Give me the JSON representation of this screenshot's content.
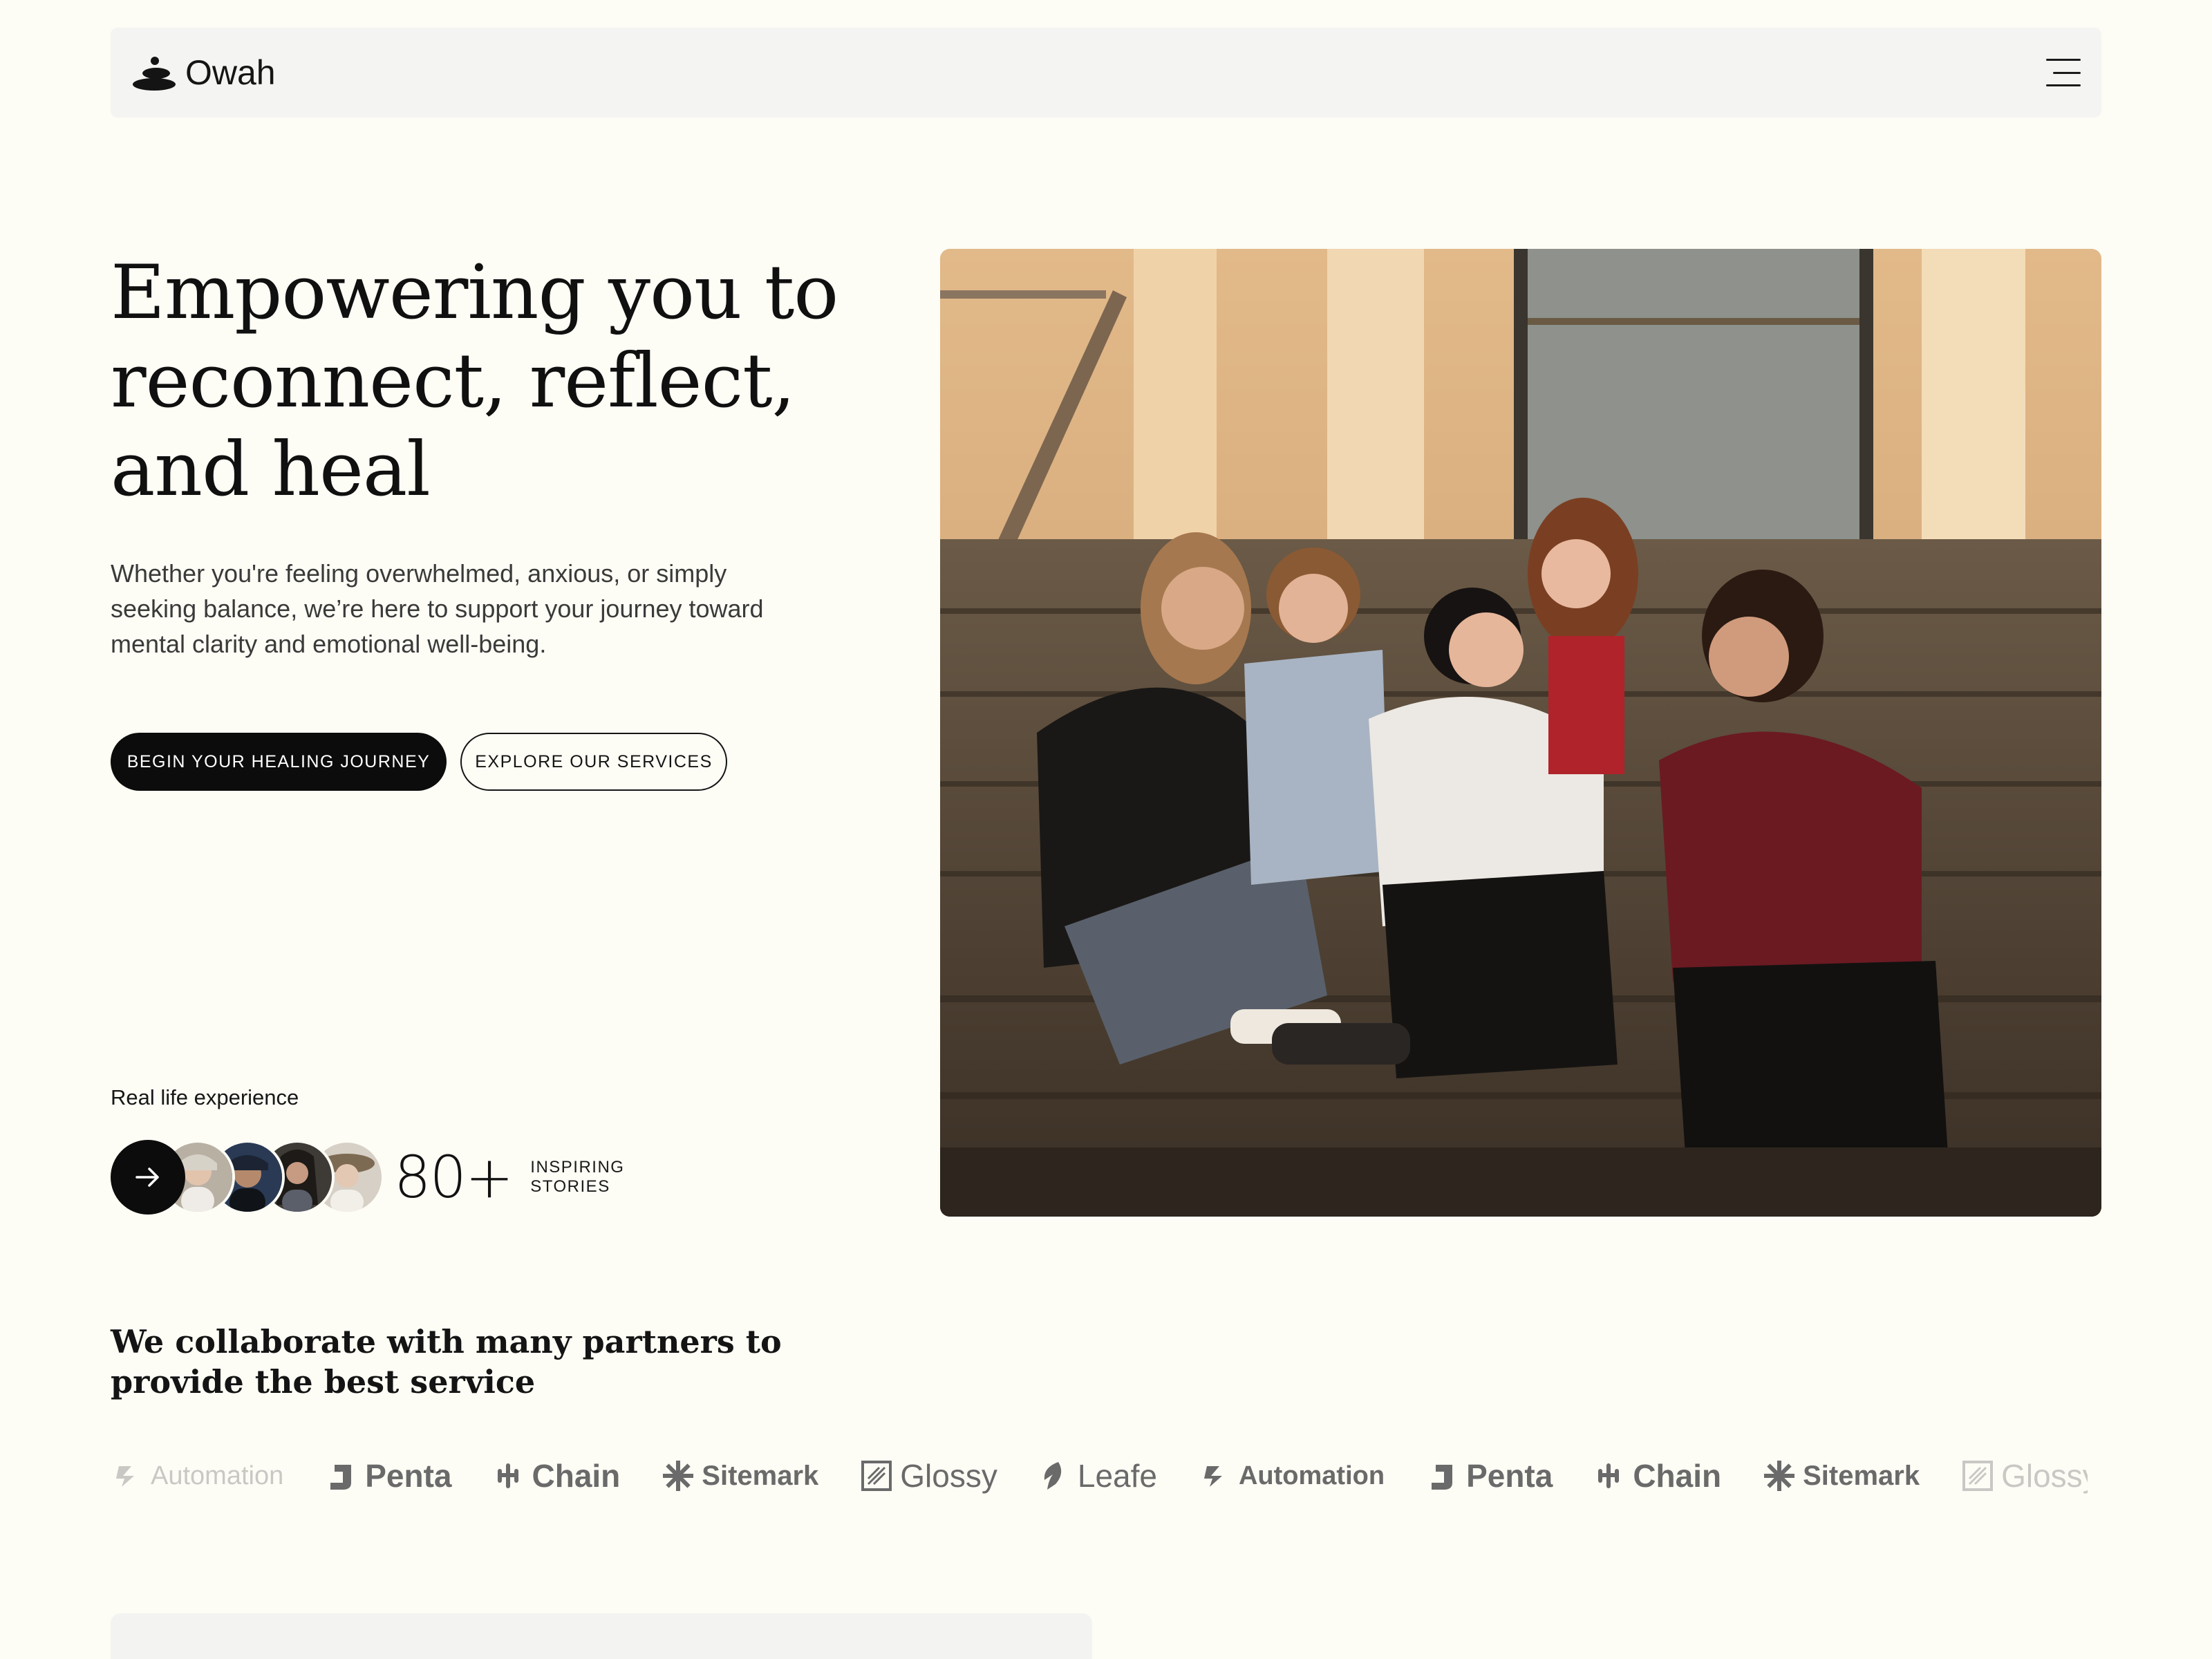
{
  "brand": {
    "name": "Owah",
    "logo_icon": "stones-icon"
  },
  "nav": {
    "menu_icon": "menu-icon"
  },
  "hero": {
    "title": "Empowering you to reconnect, reflect, and heal",
    "description": "Whether you're feeling overwhelmed, anxious, or simply seeking balance, we’re here to support your journey toward mental clarity and emotional well-being.",
    "primary_cta": "BEGIN YOUR HEALING JOURNEY",
    "secondary_cta": "EXPLORE OUR SERVICES"
  },
  "stories": {
    "caption": "Real life experience",
    "count": "80+",
    "label_line1": "INSPIRING",
    "label_line2": "STORIES"
  },
  "partners": {
    "title": "We collaborate with many partners to provide the best service",
    "logos": [
      {
        "name": "Automation",
        "icon": "automation-icon",
        "faded": true
      },
      {
        "name": "Penta",
        "icon": "penta-icon"
      },
      {
        "name": "Chain",
        "icon": "chain-icon"
      },
      {
        "name": "Sitemark",
        "icon": "sitemark-icon"
      },
      {
        "name": "Glossy",
        "icon": "glossy-icon"
      },
      {
        "name": "Leafe",
        "icon": "leafe-icon"
      },
      {
        "name": "Automation",
        "icon": "automation-icon"
      },
      {
        "name": "Penta",
        "icon": "penta-icon"
      },
      {
        "name": "Chain",
        "icon": "chain-icon"
      },
      {
        "name": "Sitemark",
        "icon": "sitemark-icon"
      },
      {
        "name": "Glossy",
        "icon": "glossy-icon",
        "faded": true
      }
    ]
  },
  "colors": {
    "background": "#fdfcf5",
    "primary": "#0c0c0c",
    "nav_bg": "#f4f4f2",
    "logo_gray": "#6a6a6a"
  }
}
